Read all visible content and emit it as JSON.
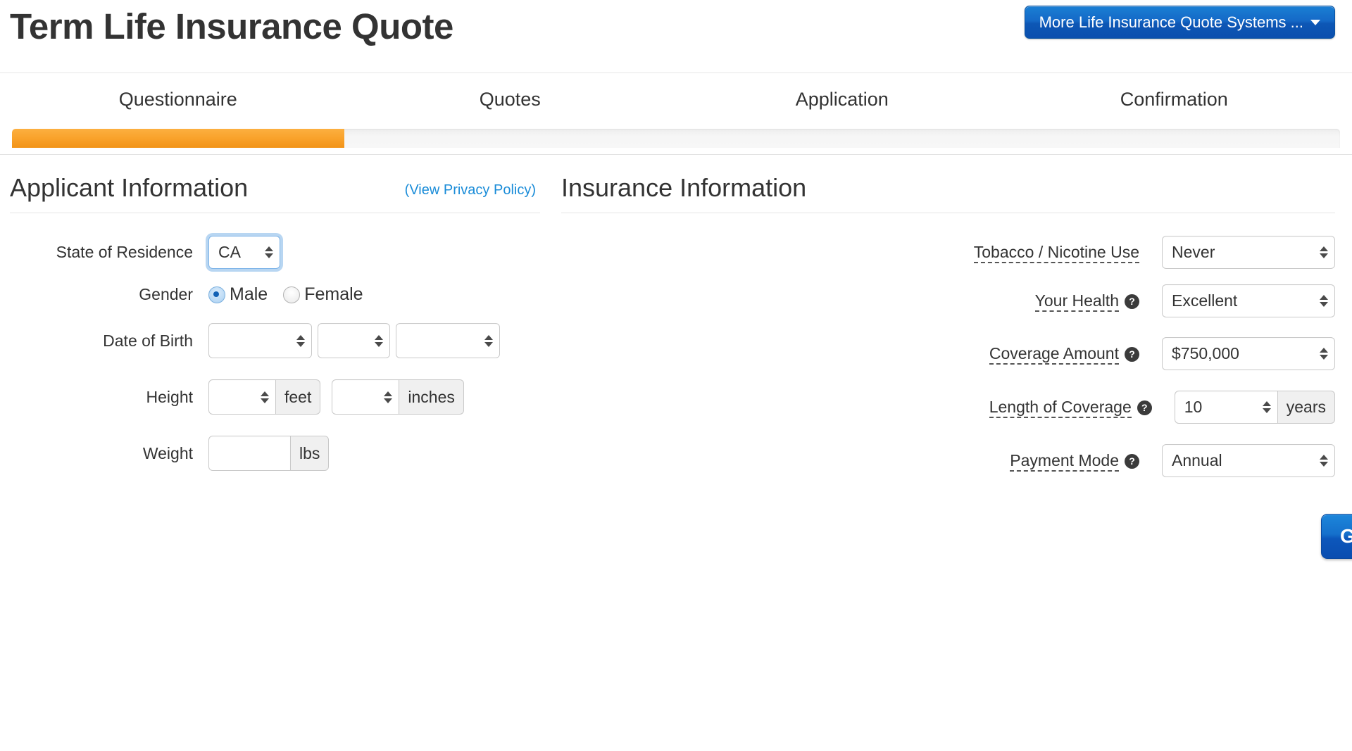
{
  "header": {
    "title": "Term Life Insurance Quote",
    "more_systems_label": "More Life Insurance Quote Systems ...",
    "caret_icon": "chevron-down-icon",
    "button_color": "#1569c7"
  },
  "steps": {
    "items": [
      {
        "label": "Questionnaire"
      },
      {
        "label": "Quotes"
      },
      {
        "label": "Application"
      },
      {
        "label": "Confirmation"
      }
    ],
    "active_index": 0,
    "progress_percent": 25,
    "progress_color": "#f9a22b",
    "track_color": "#f4f4f4"
  },
  "applicant": {
    "section_title": "Applicant Information",
    "privacy_link": "(View Privacy Policy)",
    "privacy_link_color": "#1a8cd8",
    "state": {
      "label": "State of Residence",
      "value": "CA",
      "focused": true
    },
    "gender": {
      "label": "Gender",
      "options": [
        {
          "label": "Male",
          "checked": true
        },
        {
          "label": "Female",
          "checked": false
        }
      ]
    },
    "dob": {
      "label": "Date of Birth",
      "month": "",
      "day": "",
      "year": ""
    },
    "height": {
      "label": "Height",
      "feet_value": "",
      "feet_addon": "feet",
      "inches_value": "",
      "inches_addon": "inches"
    },
    "weight": {
      "label": "Weight",
      "value": "",
      "addon": "lbs"
    }
  },
  "insurance": {
    "section_title": "Insurance Information",
    "help_icon": "question-mark-icon",
    "tobacco": {
      "label": "Tobacco / Nicotine Use",
      "value": "Never",
      "has_help": false
    },
    "health": {
      "label": "Your Health",
      "value": "Excellent",
      "has_help": true
    },
    "coverage_amount": {
      "label": "Coverage Amount",
      "value": "$750,000",
      "has_help": true
    },
    "length_of_coverage": {
      "label": "Length of Coverage",
      "value": "10",
      "addon": "years",
      "has_help": true
    },
    "payment_mode": {
      "label": "Payment Mode",
      "value": "Annual",
      "has_help": true
    },
    "submit_label": "Get Quotes »"
  }
}
